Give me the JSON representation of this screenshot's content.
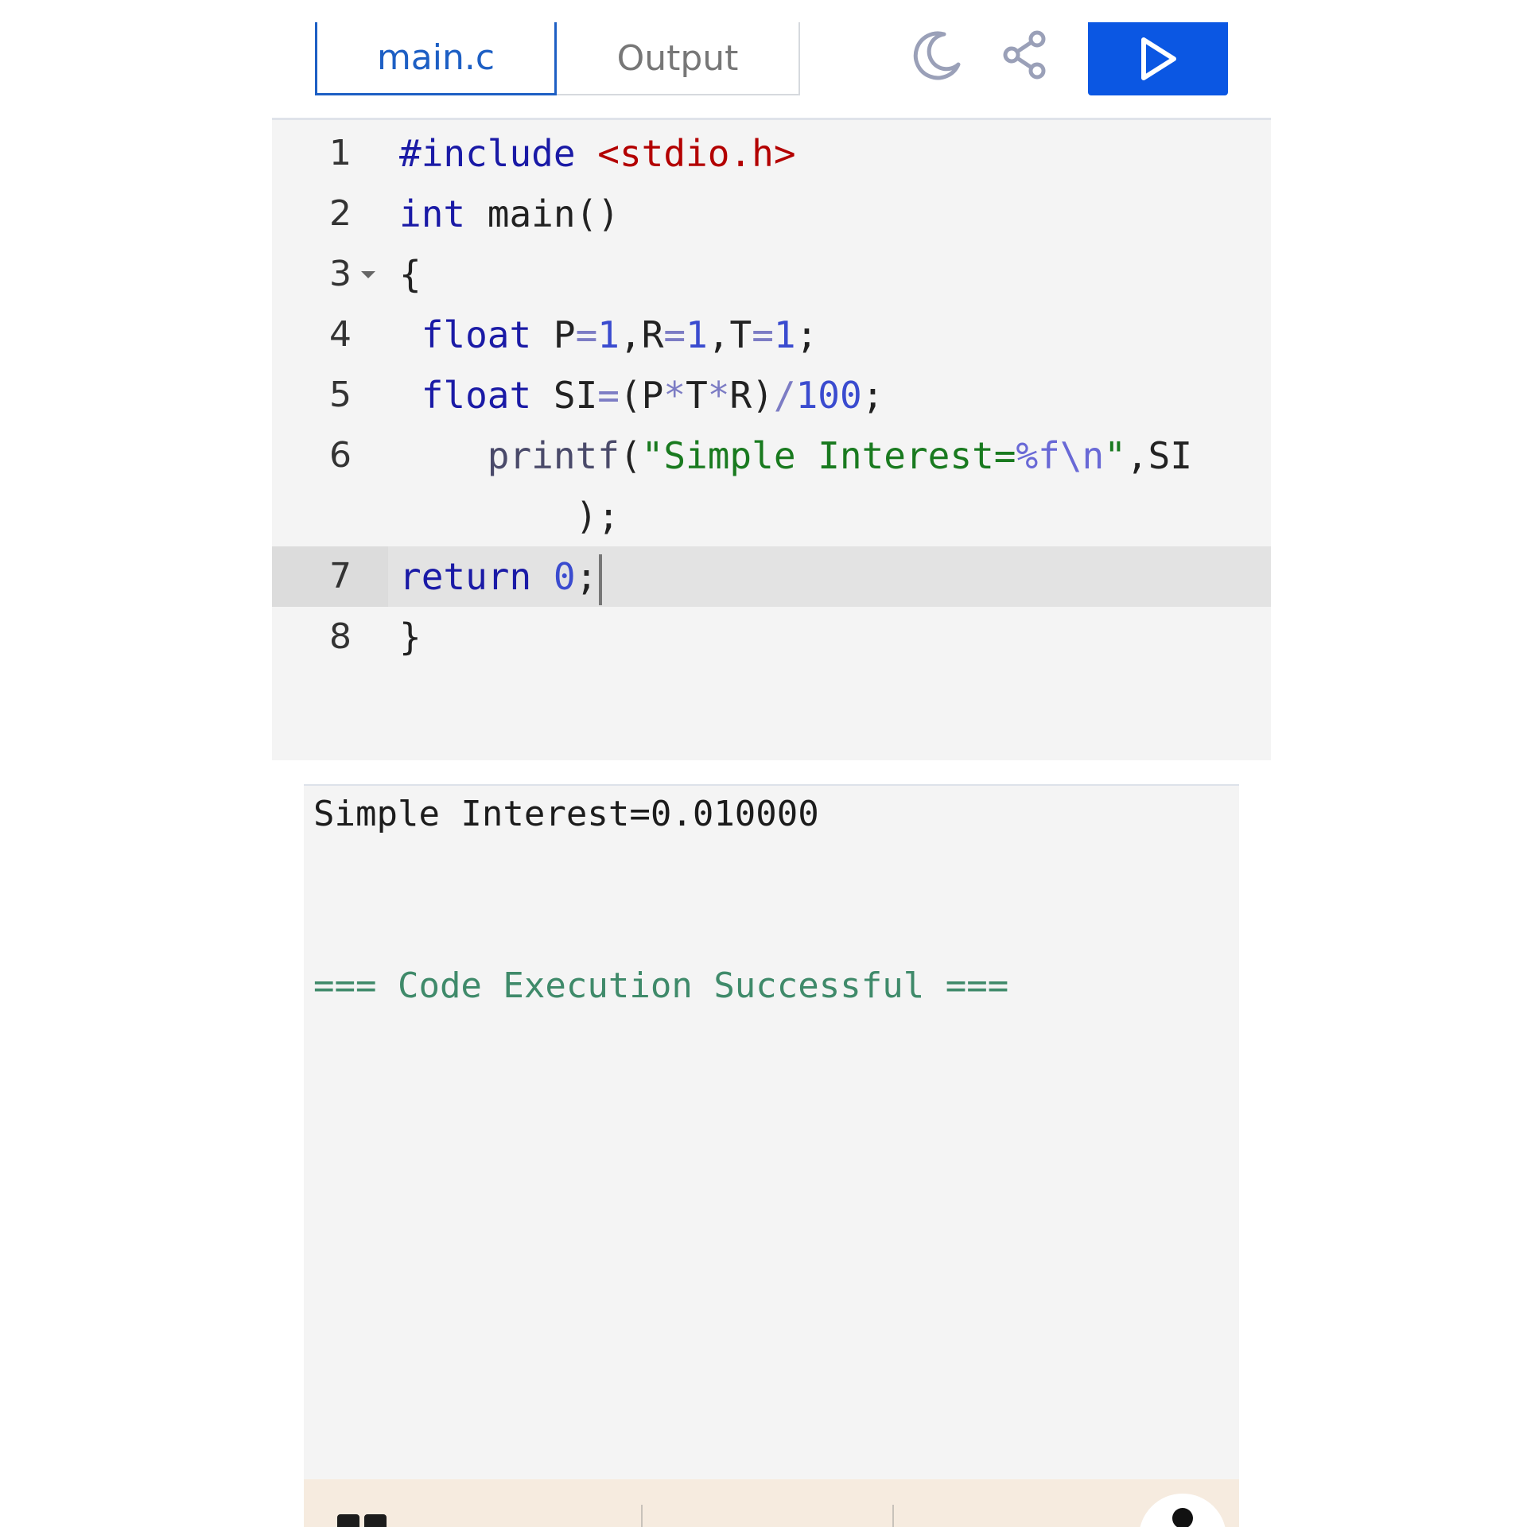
{
  "tabs": {
    "editor": "main.c",
    "output": "Output"
  },
  "toolbar": {
    "theme_icon": "moon-icon",
    "share_icon": "share-icon",
    "run_icon": "play-icon",
    "accent_color": "#0b57e3"
  },
  "editor": {
    "line_numbers": [
      "1",
      "2",
      "3",
      "4",
      "5",
      "6",
      "7",
      "8"
    ],
    "active_line": "7",
    "code": {
      "l1_kw": "#include",
      "l1_header": "<stdio.h>",
      "l2_kw": "int",
      "l2_rest": "main()",
      "l3": "{",
      "l4_kw": "float",
      "l4_a": "P",
      "l4_b": "=",
      "l4_c": "1",
      "l4_d": ",R",
      "l4_e": "=",
      "l4_f": "1",
      "l4_g": ",T",
      "l4_h": "=",
      "l4_i": "1",
      "l4_j": ";",
      "l5_kw": "float",
      "l5_a": "SI",
      "l5_b": "=",
      "l5_c": "(P",
      "l5_d": "*",
      "l5_e": "T",
      "l5_f": "*",
      "l5_g": "R)",
      "l5_h": "/",
      "l5_i": "100",
      "l5_j": ";",
      "l6_fn": "printf",
      "l6_a": "(",
      "l6_str": "\"Simple Interest=",
      "l6_esc": "%f\\n",
      "l6_q": "\"",
      "l6_b": ",SI",
      "l6_wrap": ");",
      "l7_kw": "return",
      "l7_num": "0",
      "l7_semi": ";",
      "l8": "}"
    }
  },
  "output": {
    "result": "Simple Interest=0.010000",
    "status": "=== Code Execution Successful ==="
  }
}
